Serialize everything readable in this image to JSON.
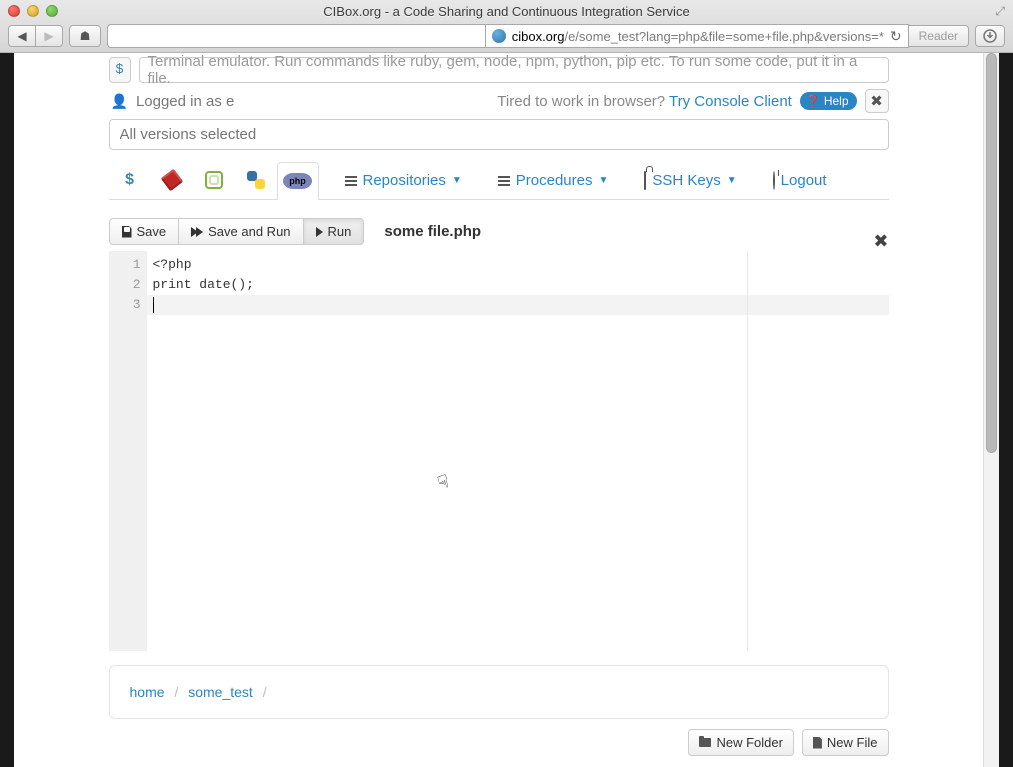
{
  "window": {
    "title": "CIBox.org - a Code Sharing and Continuous Integration Service",
    "url_host": "cibox.org",
    "url_path": "/e/some_test?lang=php&file=some+file.php&versions=*",
    "reader_label": "Reader"
  },
  "terminal": {
    "prompt": "$",
    "placeholder": "Terminal emulator. Run commands like ruby, gem, node, npm, python, pip etc. To run some code, put it in a file."
  },
  "status": {
    "logged_in": "Logged in as e",
    "tired": "Tired to work in browser? ",
    "console_link": "Try Console Client",
    "help": "Help"
  },
  "versions_placeholder": "All versions selected",
  "nav": {
    "repositories": "Repositories",
    "procedures": "Procedures",
    "ssh": "SSH Keys",
    "logout": "Logout",
    "php_label": "php"
  },
  "editor": {
    "save": "Save",
    "save_and_run": "Save and Run",
    "run": "Run",
    "filename": "some file.php",
    "lines": [
      "1",
      "2",
      "3"
    ],
    "code": [
      "<?php",
      "print date();",
      ""
    ]
  },
  "breadcrumb": {
    "home": "home",
    "project": "some_test"
  },
  "footer": {
    "new_folder": "New Folder",
    "new_file": "New File"
  }
}
